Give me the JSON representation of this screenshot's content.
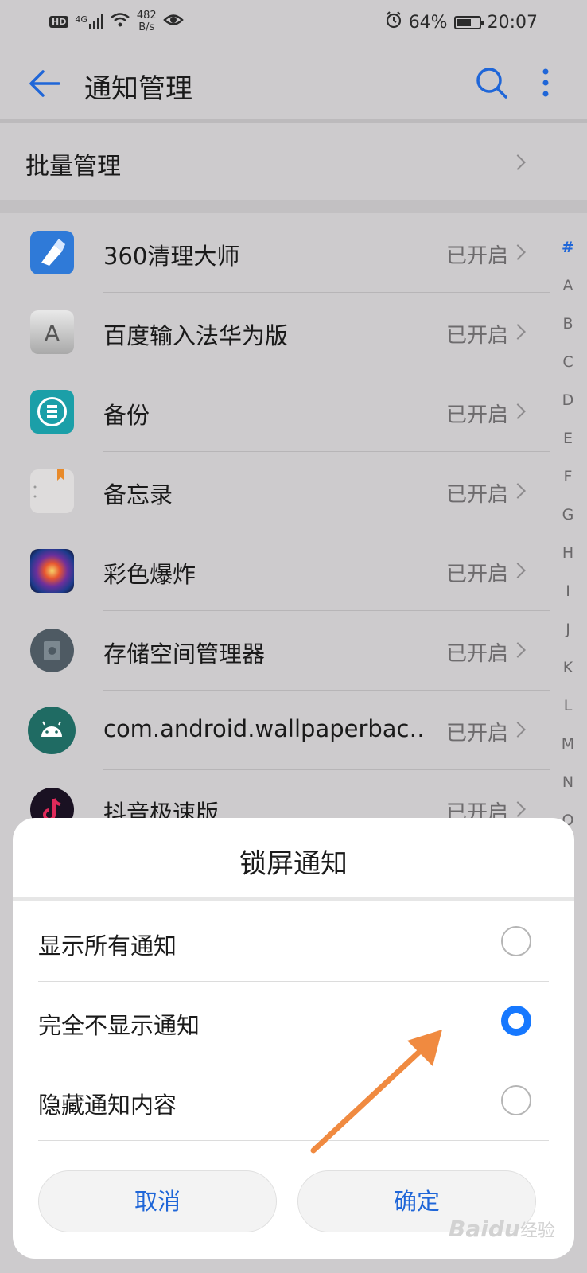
{
  "status": {
    "hd": "HD",
    "network": "4G",
    "speed_value": "482",
    "speed_unit": "B/s",
    "battery": "64%",
    "battery_level": 0.64,
    "time": "20:07"
  },
  "appbar": {
    "title": "通知管理"
  },
  "batch": {
    "label": "批量管理"
  },
  "apps": [
    {
      "name": "360清理大师",
      "state": "已开启",
      "icon": "360-cleaner-icon"
    },
    {
      "name": "百度输入法华为版",
      "state": "已开启",
      "icon": "baidu-input-icon"
    },
    {
      "name": "备份",
      "state": "已开启",
      "icon": "backup-icon"
    },
    {
      "name": "备忘录",
      "state": "已开启",
      "icon": "notepad-icon"
    },
    {
      "name": "彩色爆炸",
      "state": "已开启",
      "icon": "color-explosion-icon"
    },
    {
      "name": "存储空间管理器",
      "state": "已开启",
      "icon": "storage-manager-icon"
    },
    {
      "name": "com.android.wallpaperbac…",
      "state": "已开启",
      "icon": "android-icon"
    },
    {
      "name": "抖音极速版",
      "state": "已开启",
      "icon": "douyin-icon"
    }
  ],
  "index": [
    "#",
    "A",
    "B",
    "C",
    "D",
    "E",
    "F",
    "G",
    "H",
    "I",
    "J",
    "K",
    "L",
    "M",
    "N",
    "O"
  ],
  "sheet": {
    "title": "锁屏通知",
    "options": [
      {
        "label": "显示所有通知",
        "selected": false
      },
      {
        "label": "完全不显示通知",
        "selected": true
      },
      {
        "label": "隐藏通知内容",
        "selected": false
      }
    ],
    "cancel": "取消",
    "confirm": "确定"
  },
  "watermark": {
    "latin": "Baidu",
    "cn": "经验"
  },
  "colors": {
    "accent": "#1678ff",
    "link": "#1f66d8",
    "arrow": "#f08a40"
  }
}
